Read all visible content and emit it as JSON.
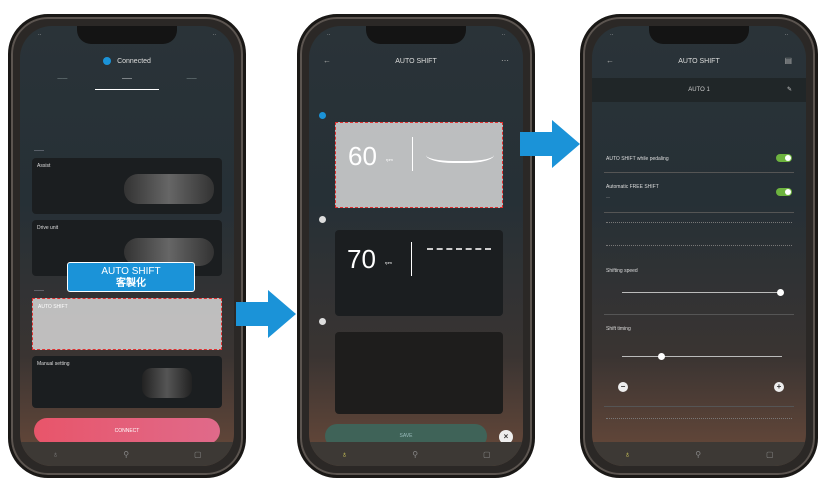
{
  "callout": {
    "line1": "AUTO SHIFT",
    "line2": "客製化"
  },
  "phone1": {
    "title": "Connected",
    "tabs": [
      "",
      "",
      ""
    ],
    "cards": [
      "Assist",
      "Drive unit",
      "AUTO SHIFT",
      "Manual setting"
    ],
    "button": "CONNECT"
  },
  "phone2": {
    "title": "AUTO SHIFT",
    "profile1": {
      "cadence": "60",
      "unit": "rpm"
    },
    "profile2": {
      "cadence": "70",
      "unit": "rpm"
    },
    "button": "SAVE"
  },
  "phone3": {
    "title": "AUTO SHIFT",
    "subtitle": "AUTO 1",
    "row1": "AUTO SHIFT while pedaling",
    "row2": "Automatic FREE SHIFT",
    "slider1_label": "Shifting speed",
    "slider2_label": "Shift timing",
    "slider1_value": 0.97,
    "slider2_value": 0.28
  },
  "colors": {
    "accent": "#1b93d8",
    "toggle_on": "#6db33f",
    "highlight_border": "#e03030",
    "button_pink": "#e8556a"
  }
}
